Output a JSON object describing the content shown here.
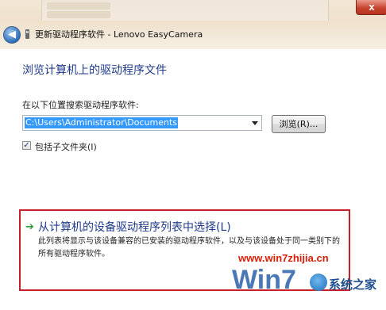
{
  "window": {
    "title": "更新驱动程序软件 - Lenovo EasyCamera",
    "close_label": "x",
    "back_label": "◀"
  },
  "main": {
    "heading": "浏览计算机上的驱动程序文件",
    "search_label": "在以下位置搜索驱动程序软件:",
    "path_value": "C:\\Users\\Administrator\\Documents",
    "browse_label": "浏览(R)...",
    "include_subfolders_label": "包括子文件夹(I)",
    "include_subfolders_checked": true,
    "checkmark": "✓"
  },
  "option": {
    "arrow": "➔",
    "title": "从计算机的设备驱动程序列表中选择(L)",
    "description": "此列表将显示与该设备兼容的已安装的驱动程序软件，以及与该设备处于同一类别下的所有驱动程序软件。"
  },
  "watermark": {
    "url": "www.win7zhijia.cn",
    "logo_text": "Win7",
    "site_name": "系统之家"
  },
  "colors": {
    "heading": "#1e3a8a",
    "highlight_border": "#c8202a",
    "selection": "#3399ff",
    "watermark_red": "#d81e06"
  }
}
